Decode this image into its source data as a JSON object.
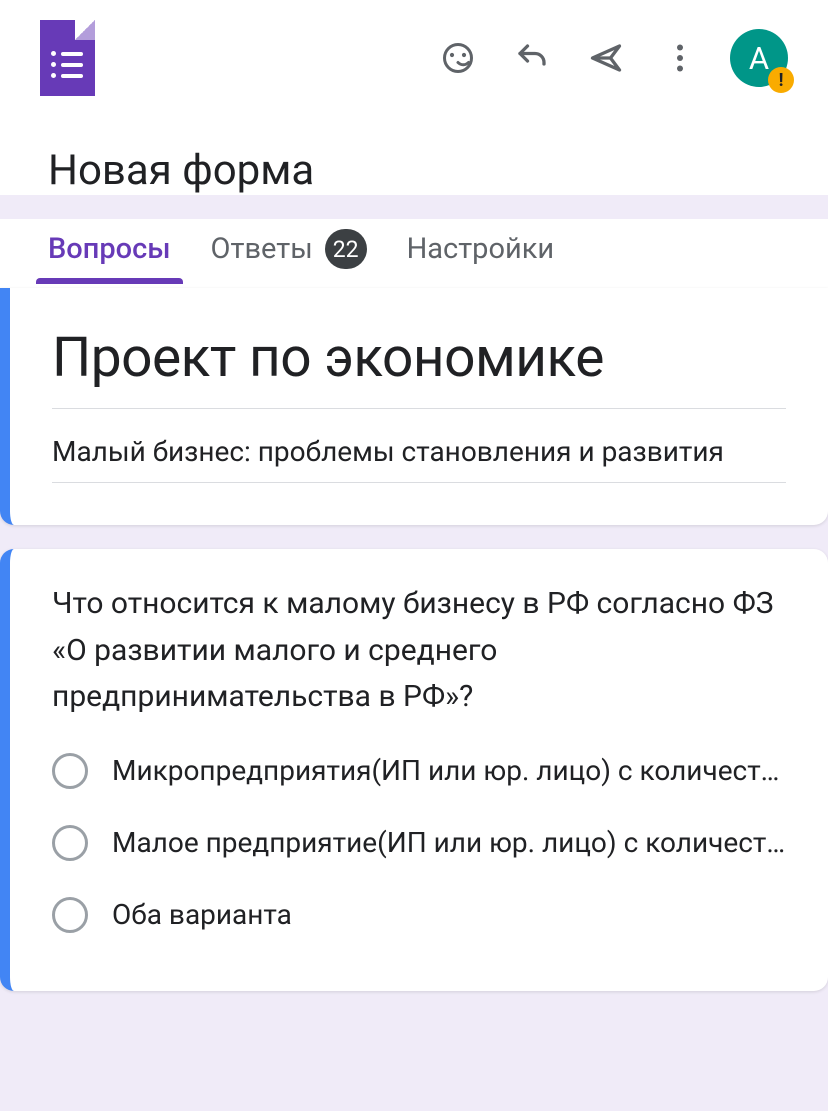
{
  "header": {
    "avatar_initial": "А"
  },
  "form_name": "Новая форма",
  "tabs": {
    "questions": "Вопросы",
    "responses": "Ответы",
    "responses_count": "22",
    "settings": "Настройки"
  },
  "form": {
    "title": "Проект по экономике",
    "description": "Малый бизнес: проблемы становления и развития"
  },
  "question1": {
    "text": "Что относится к малому бизнесу в РФ согласно ФЗ «О развитии малого и среднего предпринимательства в РФ»?",
    "options": [
      "Микропредприятия(ИП или юр. лицо) с количеств…",
      "Малое предприятие(ИП или юр. лицо) с количест…",
      "Оба варианта"
    ]
  }
}
